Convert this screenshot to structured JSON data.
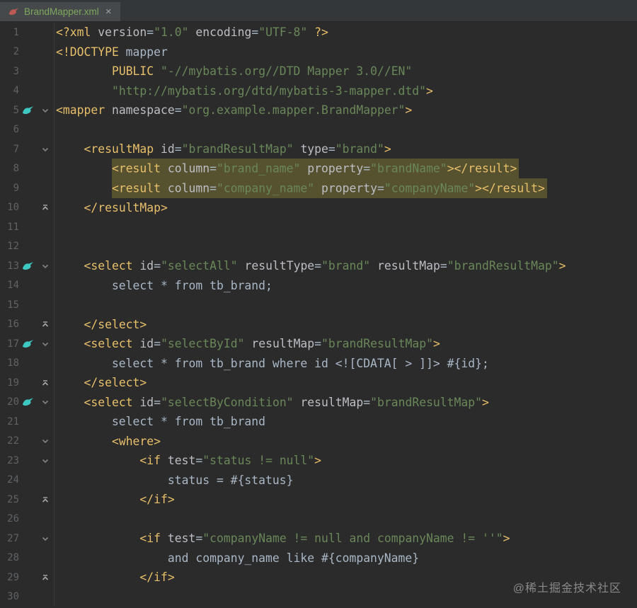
{
  "tab": {
    "title": "BrandMapper.xml",
    "close_glyph": "×"
  },
  "icons": {
    "tab_file_icon": "mybatis-bird-red",
    "gutter_bird_icon": "mybatis-bird-teal",
    "fold_start_icon": "chevron-down",
    "fold_end_icon": "chevron-up",
    "close_icon": "x-cross"
  },
  "colors": {
    "editorBg": "#2b2b2b",
    "tabbarBg": "#34373a",
    "tabBg": "#45494c",
    "tabText": "#7ea75c",
    "closeIcon": "#9da0a3",
    "lineNumber": "#606366",
    "tag": "#e8bf6a",
    "attr": "#bcbec4",
    "str": "#6a8759",
    "txt": "#a9b7c6",
    "highlight": "#565230",
    "birdTeal": "#3ec6c0",
    "birdRed": "#bb5a52",
    "foldDown": "#7f8487",
    "foldUp": "#a6a9ac",
    "gutterLine": "#383b3d",
    "watermark": "#9a9a9a"
  },
  "editor": {
    "lines": [
      {
        "n": 1,
        "g": [],
        "t": [
          [
            "tag",
            "<?xml "
          ],
          [
            "attr",
            "version"
          ],
          [
            "txt",
            "="
          ],
          [
            "str",
            "\"1.0\""
          ],
          [
            "txt",
            " "
          ],
          [
            "attr",
            "encoding"
          ],
          [
            "txt",
            "="
          ],
          [
            "str",
            "\"UTF-8\""
          ],
          [
            "txt",
            " "
          ],
          [
            "tag",
            "?>"
          ]
        ]
      },
      {
        "n": 2,
        "g": [],
        "t": [
          [
            "tag",
            "<!DOCTYPE"
          ],
          [
            "txt",
            " mapper"
          ]
        ]
      },
      {
        "n": 3,
        "g": [],
        "t": [
          [
            "txt",
            "        "
          ],
          [
            "tag",
            "PUBLIC"
          ],
          [
            "txt",
            " "
          ],
          [
            "str",
            "\"-//mybatis.org//DTD Mapper 3.0//EN\""
          ]
        ]
      },
      {
        "n": 4,
        "g": [],
        "t": [
          [
            "txt",
            "        "
          ],
          [
            "str",
            "\"http://mybatis.org/dtd/mybatis-3-mapper.dtd\""
          ],
          [
            "tag",
            ">"
          ]
        ]
      },
      {
        "n": 5,
        "g": [
          "bird",
          "down"
        ],
        "t": [
          [
            "tag",
            "<mapper"
          ],
          [
            "txt",
            " "
          ],
          [
            "attr",
            "namespace"
          ],
          [
            "txt",
            "="
          ],
          [
            "str",
            "\"org.example.mapper.BrandMapper\""
          ],
          [
            "tag",
            ">"
          ]
        ]
      },
      {
        "n": 6,
        "g": [],
        "t": []
      },
      {
        "n": 7,
        "g": [
          "down"
        ],
        "t": [
          [
            "txt",
            "    "
          ],
          [
            "tag",
            "<resultMap"
          ],
          [
            "txt",
            " "
          ],
          [
            "attr",
            "id"
          ],
          [
            "txt",
            "="
          ],
          [
            "str",
            "\"brandResultMap\""
          ],
          [
            "txt",
            " "
          ],
          [
            "attr",
            "type"
          ],
          [
            "txt",
            "="
          ],
          [
            "str",
            "\"brand\""
          ],
          [
            "tag",
            ">"
          ]
        ]
      },
      {
        "n": 8,
        "g": [],
        "hl": 1,
        "t": [
          [
            "txt",
            "        "
          ],
          [
            "tag",
            "<result"
          ],
          [
            "txt",
            " "
          ],
          [
            "attr",
            "column"
          ],
          [
            "txt",
            "="
          ],
          [
            "str",
            "\"brand_name\""
          ],
          [
            "txt",
            " "
          ],
          [
            "attr",
            "property"
          ],
          [
            "txt",
            "="
          ],
          [
            "str",
            "\"brandName\""
          ],
          [
            "tag",
            "></result>"
          ]
        ]
      },
      {
        "n": 9,
        "g": [],
        "hl": 1,
        "t": [
          [
            "txt",
            "        "
          ],
          [
            "tag",
            "<result"
          ],
          [
            "txt",
            " "
          ],
          [
            "attr",
            "column"
          ],
          [
            "txt",
            "="
          ],
          [
            "str",
            "\"company_name\""
          ],
          [
            "txt",
            " "
          ],
          [
            "attr",
            "property"
          ],
          [
            "txt",
            "="
          ],
          [
            "str",
            "\"companyName\""
          ],
          [
            "tag",
            "></result>"
          ]
        ]
      },
      {
        "n": 10,
        "g": [
          "up"
        ],
        "t": [
          [
            "txt",
            "    "
          ],
          [
            "tag",
            "</resultMap>"
          ]
        ]
      },
      {
        "n": 11,
        "g": [],
        "t": []
      },
      {
        "n": 12,
        "g": [],
        "t": []
      },
      {
        "n": 13,
        "g": [
          "bird",
          "down"
        ],
        "t": [
          [
            "txt",
            "    "
          ],
          [
            "tag",
            "<select"
          ],
          [
            "txt",
            " "
          ],
          [
            "attr",
            "id"
          ],
          [
            "txt",
            "="
          ],
          [
            "str",
            "\"selectAll\""
          ],
          [
            "txt",
            " "
          ],
          [
            "attr",
            "resultType"
          ],
          [
            "txt",
            "="
          ],
          [
            "str",
            "\"brand\""
          ],
          [
            "txt",
            " "
          ],
          [
            "attr",
            "resultMap"
          ],
          [
            "txt",
            "="
          ],
          [
            "str",
            "\"brandResultMap\""
          ],
          [
            "tag",
            ">"
          ]
        ]
      },
      {
        "n": 14,
        "g": [],
        "t": [
          [
            "txt",
            "        select * from tb_brand;"
          ]
        ]
      },
      {
        "n": 15,
        "g": [],
        "t": []
      },
      {
        "n": 16,
        "g": [
          "up"
        ],
        "t": [
          [
            "txt",
            "    "
          ],
          [
            "tag",
            "</select>"
          ]
        ]
      },
      {
        "n": 17,
        "g": [
          "bird",
          "down"
        ],
        "t": [
          [
            "txt",
            "    "
          ],
          [
            "tag",
            "<select"
          ],
          [
            "txt",
            " "
          ],
          [
            "attr",
            "id"
          ],
          [
            "txt",
            "="
          ],
          [
            "str",
            "\"selectById\""
          ],
          [
            "txt",
            " "
          ],
          [
            "attr",
            "resultMap"
          ],
          [
            "txt",
            "="
          ],
          [
            "str",
            "\"brandResultMap\""
          ],
          [
            "tag",
            ">"
          ]
        ]
      },
      {
        "n": 18,
        "g": [],
        "t": [
          [
            "txt",
            "        select * from tb_brand where id <![CDATA[ > ]]> #{id};"
          ]
        ]
      },
      {
        "n": 19,
        "g": [
          "up"
        ],
        "t": [
          [
            "txt",
            "    "
          ],
          [
            "tag",
            "</select>"
          ]
        ]
      },
      {
        "n": 20,
        "g": [
          "bird",
          "down"
        ],
        "t": [
          [
            "txt",
            "    "
          ],
          [
            "tag",
            "<select"
          ],
          [
            "txt",
            " "
          ],
          [
            "attr",
            "id"
          ],
          [
            "txt",
            "="
          ],
          [
            "str",
            "\"selectByCondition\""
          ],
          [
            "txt",
            " "
          ],
          [
            "attr",
            "resultMap"
          ],
          [
            "txt",
            "="
          ],
          [
            "str",
            "\"brandResultMap\""
          ],
          [
            "tag",
            ">"
          ]
        ]
      },
      {
        "n": 21,
        "g": [],
        "t": [
          [
            "txt",
            "        select * from tb_brand"
          ]
        ]
      },
      {
        "n": 22,
        "g": [
          "down"
        ],
        "t": [
          [
            "txt",
            "        "
          ],
          [
            "tag",
            "<where>"
          ]
        ]
      },
      {
        "n": 23,
        "g": [
          "down"
        ],
        "t": [
          [
            "txt",
            "            "
          ],
          [
            "tag",
            "<if"
          ],
          [
            "txt",
            " "
          ],
          [
            "attr",
            "test"
          ],
          [
            "txt",
            "="
          ],
          [
            "str",
            "\"status != null\""
          ],
          [
            "tag",
            ">"
          ]
        ]
      },
      {
        "n": 24,
        "g": [],
        "t": [
          [
            "txt",
            "                status = #{status}"
          ]
        ]
      },
      {
        "n": 25,
        "g": [
          "up"
        ],
        "t": [
          [
            "txt",
            "            "
          ],
          [
            "tag",
            "</if>"
          ]
        ]
      },
      {
        "n": 26,
        "g": [],
        "t": []
      },
      {
        "n": 27,
        "g": [
          "down"
        ],
        "t": [
          [
            "txt",
            "            "
          ],
          [
            "tag",
            "<if"
          ],
          [
            "txt",
            " "
          ],
          [
            "attr",
            "test"
          ],
          [
            "txt",
            "="
          ],
          [
            "str",
            "\"companyName != null and companyName != ''\""
          ],
          [
            "tag",
            ">"
          ]
        ]
      },
      {
        "n": 28,
        "g": [],
        "t": [
          [
            "txt",
            "                and company_name like #{companyName}"
          ]
        ]
      },
      {
        "n": 29,
        "g": [
          "up"
        ],
        "t": [
          [
            "txt",
            "            "
          ],
          [
            "tag",
            "</if>"
          ]
        ]
      },
      {
        "n": 30,
        "g": [],
        "t": []
      }
    ]
  },
  "watermark": "@稀土掘金技术社区"
}
